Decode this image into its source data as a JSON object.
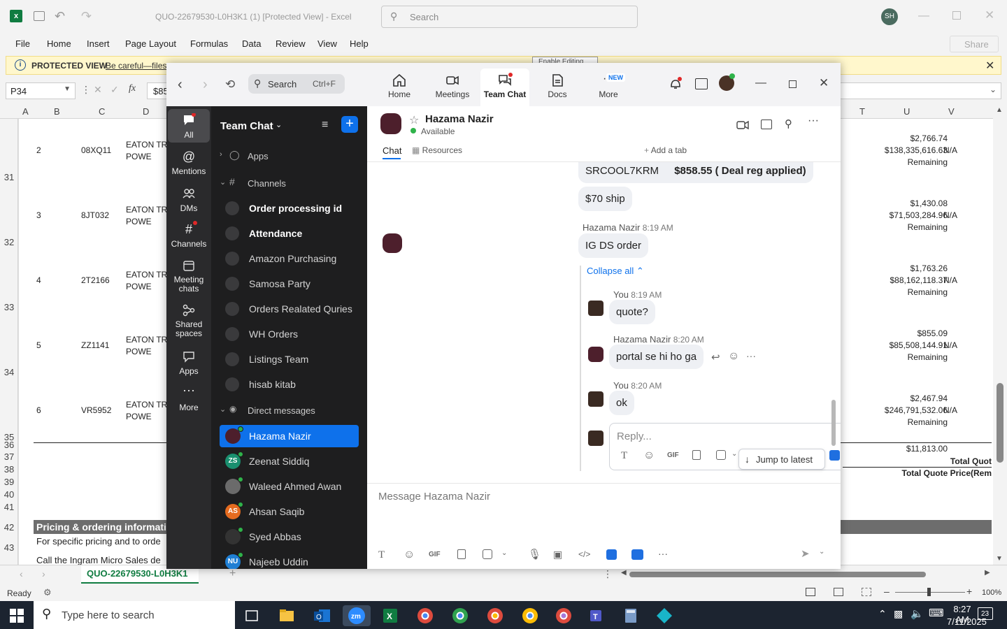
{
  "excel": {
    "title": "QUO-22679530-L0H3K1 (1)  [Protected View]  -  Excel",
    "search_placeholder": "Search",
    "user_initials": "SH",
    "menu": [
      "File",
      "Home",
      "Insert",
      "Page Layout",
      "Formulas",
      "Data",
      "Review",
      "View",
      "Help"
    ],
    "share_label": "Share",
    "protected_label": "PROTECTED VIEW",
    "protected_msg": "Be careful—files",
    "protected_tail": "Enable Editing",
    "name_box": "P34",
    "formula_value": "$85",
    "columns_left": [
      "A",
      "B",
      "C",
      "D"
    ],
    "columns_right": [
      "T",
      "U",
      "V"
    ],
    "rows": [
      {
        "row_no": "31",
        "idx": "2",
        "part": "08XQ11",
        "mfr": "EATON TRI",
        "mfr2": "POWE",
        "price": "$2,766.74",
        "total": "$138,335,616.63",
        "remaining": "Remaining",
        "na": "N/A"
      },
      {
        "row_no": "32",
        "idx": "3",
        "part": "8JT032",
        "mfr": "EATON TRI",
        "mfr2": "POWE",
        "price": "$1,430.08",
        "total": "$71,503,284.96",
        "remaining": "Remaining",
        "na": "N/A"
      },
      {
        "row_no": "33",
        "idx": "4",
        "part": "2T2166",
        "mfr": "EATON TRI",
        "mfr2": "POWE",
        "price": "$1,763.26",
        "total": "$88,162,118.37",
        "remaining": "Remaining",
        "na": "N/A"
      },
      {
        "row_no": "34",
        "idx": "5",
        "part": "ZZ1141",
        "mfr": "EATON TRI",
        "mfr2": "POWE",
        "price": "$855.09",
        "total": "$85,508,144.91",
        "remaining": "Remaining",
        "na": "N/A"
      },
      {
        "row_no": "35",
        "idx": "6",
        "part": "VR5952",
        "mfr": "EATON TRI",
        "mfr2": "POWE",
        "price": "$2,467.94",
        "total": "$246,791,532.06",
        "remaining": "Remaining",
        "na": "N/A"
      }
    ],
    "row_labels_bottom": [
      "36",
      "37",
      "38",
      "39",
      "40",
      "41",
      "42",
      "43"
    ],
    "sum_value": "$11,813.00",
    "total_quote": "Total Quot",
    "total_quote_price": "Total Quote Price(Rem",
    "pricing_header": "Pricing & ordering information",
    "pricing_line1": "For specific pricing and to orde",
    "pricing_line2": "Call the Ingram Micro Sales de",
    "sheet_tab": "QUO-22679530-L0H3K1",
    "status_ready": "Ready",
    "zoom_level": "100%"
  },
  "zoom": {
    "search_label": "Search",
    "search_shortcut": "Ctrl+F",
    "nav_tabs": [
      {
        "label": "Home"
      },
      {
        "label": "Meetings"
      },
      {
        "label": "Team Chat"
      },
      {
        "label": "Docs"
      },
      {
        "label": "More",
        "badge": "NEW"
      }
    ],
    "rail": [
      "All",
      "Mentions",
      "DMs",
      "Channels",
      "Meeting chats",
      "Shared spaces",
      "Apps",
      "More"
    ],
    "sidebar_title": "Team Chat",
    "apps_label": "Apps",
    "channels_label": "Channels",
    "channels": [
      {
        "name": "Order processing id",
        "bold": true
      },
      {
        "name": "Attendance",
        "bold": true
      },
      {
        "name": "Amazon Purchasing",
        "bold": false
      },
      {
        "name": "Samosa Party",
        "bold": false
      },
      {
        "name": "Orders Realated Quries",
        "bold": false
      },
      {
        "name": "WH Orders",
        "bold": false
      },
      {
        "name": "Listings Team",
        "bold": false
      },
      {
        "name": "hisab kitab",
        "bold": false
      }
    ],
    "dm_label": "Direct messages",
    "dms": [
      {
        "name": "Hazama Nazir",
        "initials": "",
        "color": "#4d1f2c"
      },
      {
        "name": "Zeenat Siddiq",
        "initials": "ZS",
        "color": "#1a8f6f"
      },
      {
        "name": "Waleed Ahmed Awan",
        "initials": "",
        "color": "#6b6b6b"
      },
      {
        "name": "Ahsan Saqib",
        "initials": "AS",
        "color": "#e56b1f"
      },
      {
        "name": "Syed Abbas",
        "initials": "",
        "color": "#333333"
      },
      {
        "name": "Najeeb Uddin",
        "initials": "NU",
        "color": "#1f7fd4"
      }
    ],
    "contact_name": "Hazama Nazir",
    "contact_status": "Available",
    "tabs": [
      "Chat",
      "Resources",
      "Add a tab"
    ],
    "messages": {
      "m1_line1": "SRCOOL7KRM",
      "m1_bold": "$858.55 ( Deal reg applied)",
      "m2": "$70 ship",
      "m3_sender": "Hazama Nazir",
      "m3_time": "8:19 AM",
      "m3": "IG DS order",
      "collapse": "Collapse all",
      "r1_sender": "You",
      "r1_time": "8:19 AM",
      "r1": "quote?",
      "r2_sender": "Hazama Nazir",
      "r2_time": "8:20 AM",
      "r2": "portal se hi ho ga",
      "r3_sender": "You",
      "r3_time": "8:20 AM",
      "r3": "ok"
    },
    "reply_placeholder": "Reply...",
    "jump_label": "Jump to latest",
    "message_placeholder": "Message Hazama Nazir",
    "gif_label": "GIF"
  },
  "taskbar": {
    "search_placeholder": "Type here to search",
    "time": "8:27 AM",
    "date": "7/11/2025",
    "notif_count": "23"
  },
  "colors": {
    "accent": "#0e71eb",
    "excel_green": "#107c41",
    "banner": "#fff7cc"
  }
}
